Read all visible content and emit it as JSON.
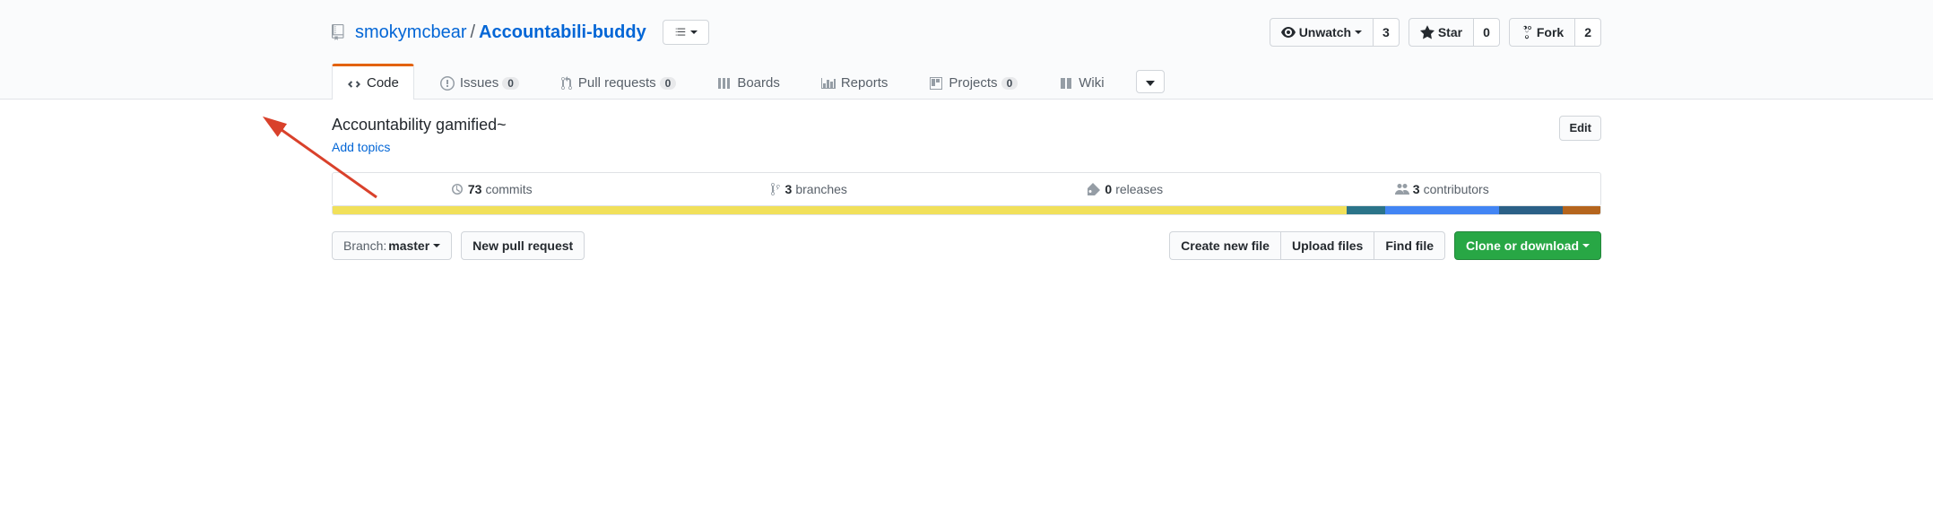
{
  "repo": {
    "owner": "smokymcbear",
    "name": "Accountabili-buddy",
    "separator": "/"
  },
  "actions": {
    "watch": {
      "label": "Unwatch",
      "count": "3"
    },
    "star": {
      "label": "Star",
      "count": "0"
    },
    "fork": {
      "label": "Fork",
      "count": "2"
    }
  },
  "tabs": {
    "code": "Code",
    "issues": {
      "label": "Issues",
      "count": "0"
    },
    "pulls": {
      "label": "Pull requests",
      "count": "0"
    },
    "boards": "Boards",
    "reports": "Reports",
    "projects": {
      "label": "Projects",
      "count": "0"
    },
    "wiki": "Wiki"
  },
  "description": "Accountability gamified~",
  "add_topics": "Add topics",
  "edit_label": "Edit",
  "summary": {
    "commits": {
      "n": "73",
      "label": "commits"
    },
    "branches": {
      "n": "3",
      "label": "branches"
    },
    "releases": {
      "n": "0",
      "label": "releases"
    },
    "contributors": {
      "n": "3",
      "label": "contributors"
    }
  },
  "lang_bar": [
    {
      "color": "#f1e05a",
      "pct": 80
    },
    {
      "color": "#2b7489",
      "pct": 3
    },
    {
      "color": "#4285f4",
      "pct": 9
    },
    {
      "color": "#2b6087",
      "pct": 5
    },
    {
      "color": "#b5651d",
      "pct": 3
    }
  ],
  "branch": {
    "prefix": "Branch:",
    "name": "master"
  },
  "file_buttons": {
    "new_pr": "New pull request",
    "create": "Create new file",
    "upload": "Upload files",
    "find": "Find file",
    "clone": "Clone or download"
  }
}
